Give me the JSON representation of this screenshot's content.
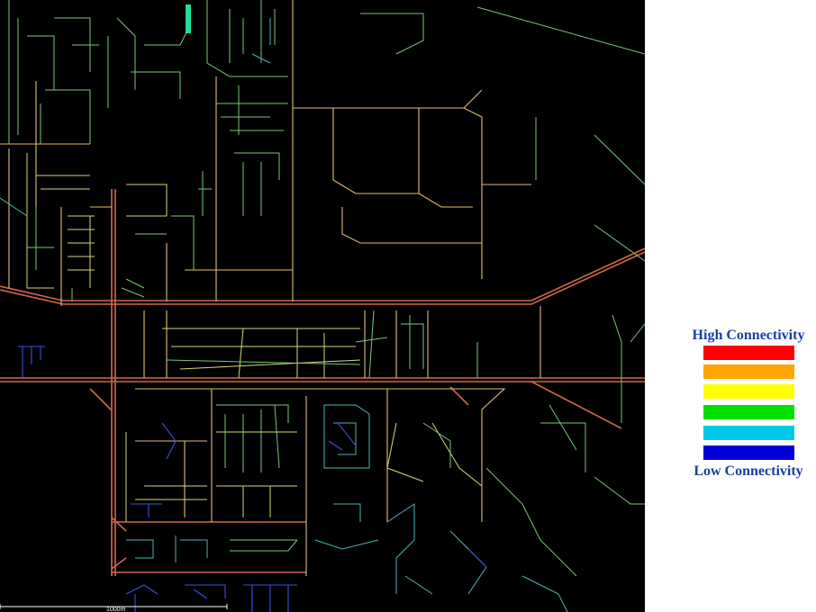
{
  "legend": {
    "high_label": "High Connectivity",
    "low_label": "Low Connectivity",
    "colors": [
      "#ff0000",
      "#ffa500",
      "#ffff00",
      "#00e000",
      "#00c8e8",
      "#0000d8"
    ]
  },
  "scale_bar": {
    "label": "1000m"
  },
  "map_colors": {
    "background": "#000000",
    "arterial": "#d2694b",
    "collector": "#e0c070",
    "local_yellow": "#d8d878",
    "local_green": "#78c878",
    "local_cyan": "#50b4b4",
    "local_blue": "#3c50e0",
    "highlight": "#20e0a0"
  }
}
